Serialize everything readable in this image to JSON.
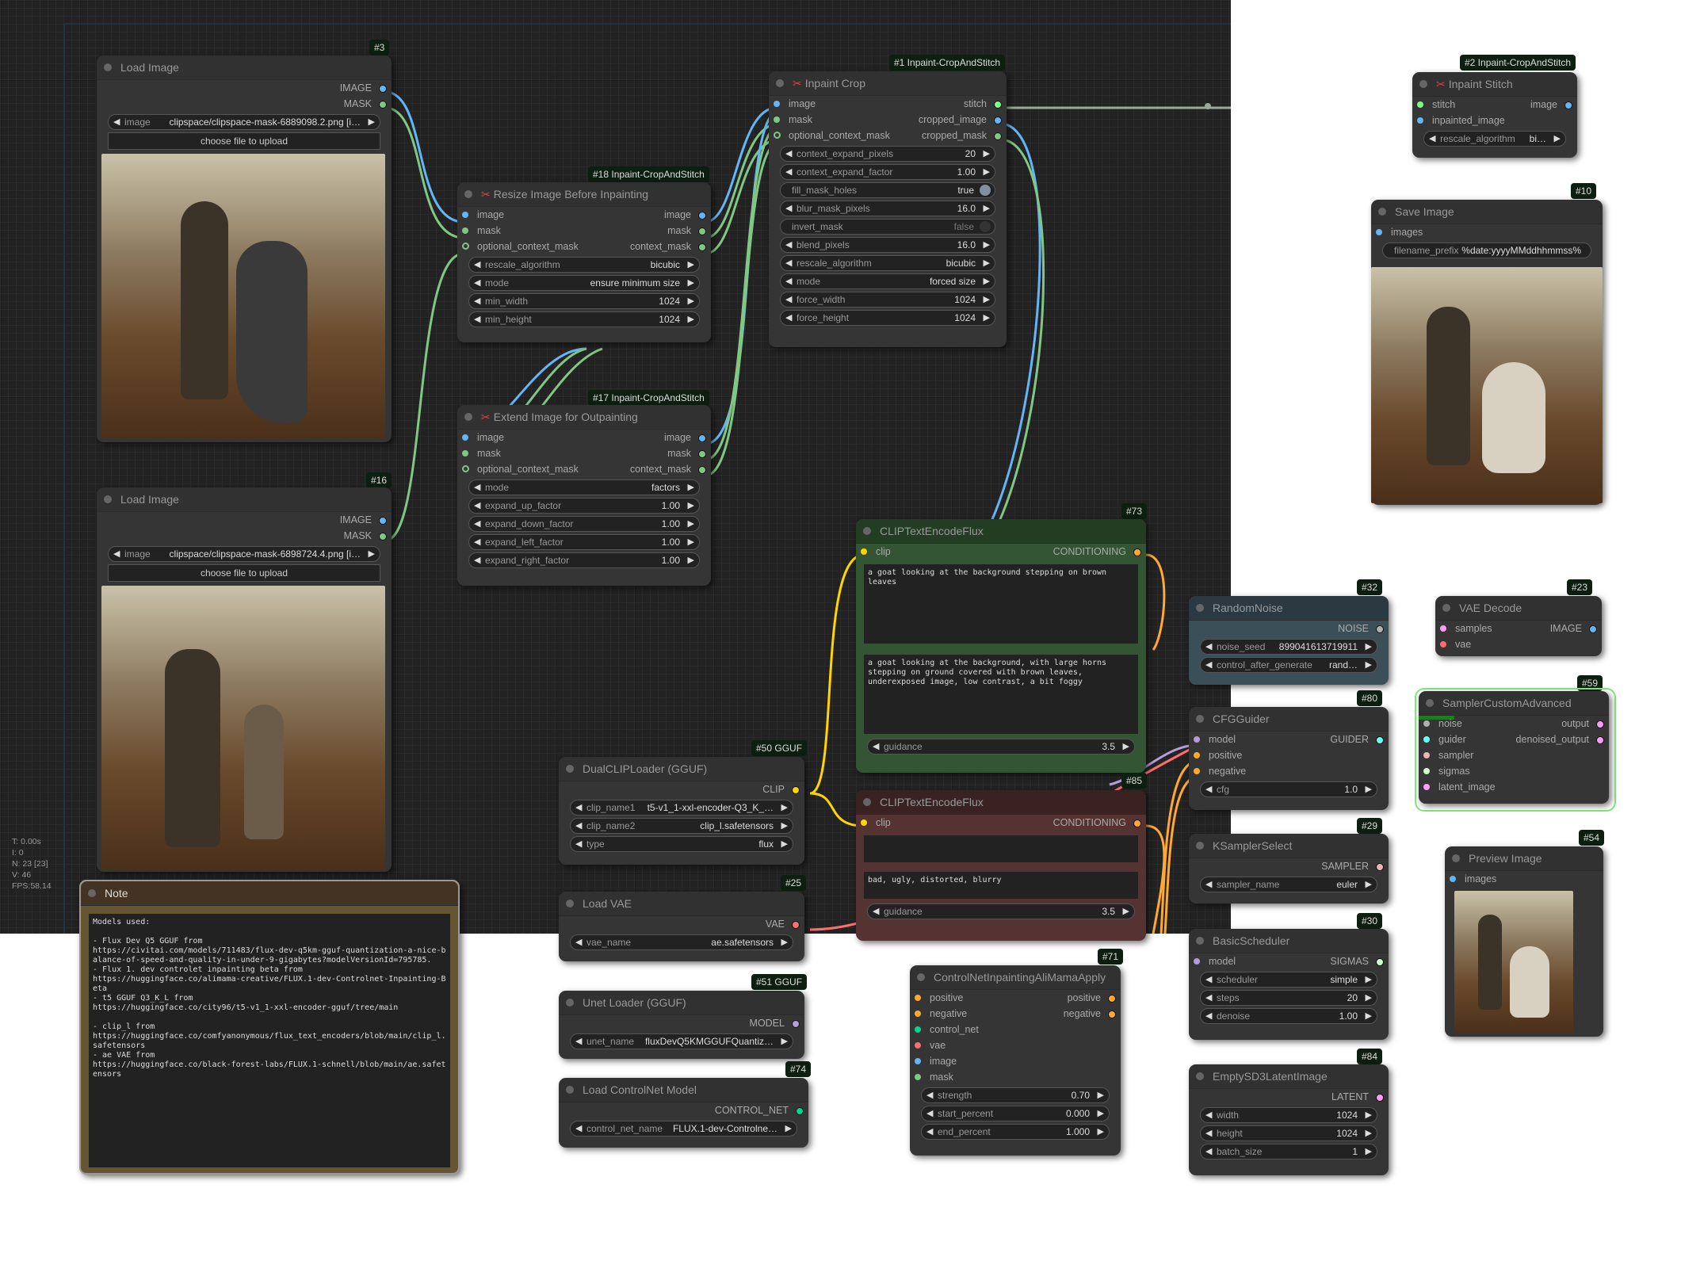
{
  "app": "ComfyUI",
  "stats": {
    "t": "T: 0.00s",
    "i": "I: 0",
    "n": "N: 23 [23]",
    "v": "V: 46",
    "fps": "FPS:58.14"
  },
  "colors": {
    "image": "#64b5f6",
    "mask": "#81c784",
    "clip": "#ffd500",
    "conditioning": "#ffa931",
    "vae": "#ff6e6e",
    "model": "#b39ddb",
    "latent": "#ff9cf9",
    "control_net": "#00d78d",
    "stitch": "#7fff7f",
    "guider": "#66ffff",
    "sampler": "#ecb4b4",
    "sigmas": "#cdffcd",
    "noise": "#b0b0b0"
  },
  "nodes": {
    "load_image_3": {
      "badge": "#3",
      "title": "Load Image",
      "outputs": [
        "IMAGE",
        "MASK"
      ],
      "image_label": "image",
      "image_value": "clipspace/clipspace-mask-6889098.2.png [i…",
      "upload": "choose file to upload"
    },
    "load_image_16": {
      "badge": "#16",
      "title": "Load Image",
      "outputs": [
        "IMAGE",
        "MASK"
      ],
      "image_label": "image",
      "image_value": "clipspace/clipspace-mask-6898724.4.png [i…",
      "upload": "choose file to upload"
    },
    "resize_18": {
      "badge": "#18 Inpaint-CropAndStitch",
      "title": "Resize Image Before Inpainting",
      "inputs": [
        "image",
        "mask",
        "optional_context_mask"
      ],
      "outputs": [
        "image",
        "mask",
        "context_mask"
      ],
      "widgets": [
        {
          "label": "rescale_algorithm",
          "value": "bicubic"
        },
        {
          "label": "mode",
          "value": "ensure minimum size"
        },
        {
          "label": "min_width",
          "value": "1024"
        },
        {
          "label": "min_height",
          "value": "1024"
        }
      ]
    },
    "extend_17": {
      "badge": "#17 Inpaint-CropAndStitch",
      "title": "Extend Image for Outpainting",
      "inputs": [
        "image",
        "mask",
        "optional_context_mask"
      ],
      "outputs": [
        "image",
        "mask",
        "context_mask"
      ],
      "widgets": [
        {
          "label": "mode",
          "value": "factors"
        },
        {
          "label": "expand_up_factor",
          "value": "1.00"
        },
        {
          "label": "expand_down_factor",
          "value": "1.00"
        },
        {
          "label": "expand_left_factor",
          "value": "1.00"
        },
        {
          "label": "expand_right_factor",
          "value": "1.00"
        }
      ]
    },
    "crop_1": {
      "badge": "#1 Inpaint-CropAndStitch",
      "title": "Inpaint Crop",
      "inputs": [
        "image",
        "mask",
        "optional_context_mask"
      ],
      "outputs": [
        "stitch",
        "cropped_image",
        "cropped_mask"
      ],
      "widgets": [
        {
          "label": "context_expand_pixels",
          "value": "20"
        },
        {
          "label": "context_expand_factor",
          "value": "1.00"
        },
        {
          "label": "fill_mask_holes",
          "value": "true",
          "toggle": true,
          "on": true
        },
        {
          "label": "blur_mask_pixels",
          "value": "16.0"
        },
        {
          "label": "invert_mask",
          "value": "false",
          "toggle": true,
          "on": false
        },
        {
          "label": "blend_pixels",
          "value": "16.0"
        },
        {
          "label": "rescale_algorithm",
          "value": "bicubic"
        },
        {
          "label": "mode",
          "value": "forced size"
        },
        {
          "label": "force_width",
          "value": "1024"
        },
        {
          "label": "force_height",
          "value": "1024"
        }
      ]
    },
    "stitch_2": {
      "badge": "#2 Inpaint-CropAndStitch",
      "title": "Inpaint Stitch",
      "inputs": [
        "stitch",
        "inpainted_image"
      ],
      "outputs": [
        "image"
      ],
      "widgets": [
        {
          "label": "rescale_algorithm",
          "value": "bi…"
        }
      ]
    },
    "save_10": {
      "badge": "#10",
      "title": "Save Image",
      "inputs": [
        "images"
      ],
      "widgets": [
        {
          "label": "filename_prefix",
          "value": "%date:yyyyMMddhhmmss%"
        }
      ]
    },
    "clip_pos_73": {
      "badge": "#73",
      "title": "CLIPTextEncodeFlux",
      "inputs": [
        "clip"
      ],
      "outputs": [
        "CONDITIONING"
      ],
      "clip_l": "a goat looking at the background stepping on brown leaves",
      "t5xxl": "a goat looking at the background, with large horns\nstepping on ground covered with brown leaves,\nunderexposed image, low contrast, a bit foggy",
      "widgets": [
        {
          "label": "guidance",
          "value": "3.5"
        }
      ]
    },
    "clip_neg_85": {
      "badge": "#85",
      "title": "CLIPTextEncodeFlux",
      "inputs": [
        "clip"
      ],
      "outputs": [
        "CONDITIONING"
      ],
      "clip_l": "",
      "t5xxl": "bad, ugly, distorted, blurry",
      "widgets": [
        {
          "label": "guidance",
          "value": "3.5"
        }
      ]
    },
    "dualclip_50": {
      "badge": "#50 GGUF",
      "title": "DualCLIPLoader (GGUF)",
      "outputs": [
        "CLIP"
      ],
      "widgets": [
        {
          "label": "clip_name1",
          "value": "t5-v1_1-xxl-encoder-Q3_K_…"
        },
        {
          "label": "clip_name2",
          "value": "clip_l.safetensors"
        },
        {
          "label": "type",
          "value": "flux"
        }
      ]
    },
    "vae_25": {
      "badge": "#25",
      "title": "Load VAE",
      "outputs": [
        "VAE"
      ],
      "widgets": [
        {
          "label": "vae_name",
          "value": "ae.safetensors"
        }
      ]
    },
    "unet_51": {
      "badge": "#51 GGUF",
      "title": "Unet Loader (GGUF)",
      "outputs": [
        "MODEL"
      ],
      "widgets": [
        {
          "label": "unet_name",
          "value": "fluxDevQ5KMGGUFQuantiz…"
        }
      ]
    },
    "controlnet_74": {
      "badge": "#74",
      "title": "Load ControlNet Model",
      "outputs": [
        "CONTROL_NET"
      ],
      "widgets": [
        {
          "label": "control_net_name",
          "value": "FLUX.1-dev-Controlne…"
        }
      ]
    },
    "cn_apply_71": {
      "badge": "#71",
      "title": "ControlNetInpaintingAliMamaApply",
      "inputs": [
        "positive",
        "negative",
        "control_net",
        "vae",
        "image",
        "mask"
      ],
      "outputs": [
        "positive",
        "negative"
      ],
      "widgets": [
        {
          "label": "strength",
          "value": "0.70"
        },
        {
          "label": "start_percent",
          "value": "0.000"
        },
        {
          "label": "end_percent",
          "value": "1.000"
        }
      ]
    },
    "noise_32": {
      "badge": "#32",
      "title": "RandomNoise",
      "outputs": [
        "NOISE"
      ],
      "widgets": [
        {
          "label": "noise_seed",
          "value": "899041613719911"
        },
        {
          "label": "control_after_generate",
          "value": "rand…"
        }
      ]
    },
    "cfg_80": {
      "badge": "#80",
      "title": "CFGGuider",
      "inputs": [
        "model",
        "positive",
        "negative"
      ],
      "outputs": [
        "GUIDER"
      ],
      "widgets": [
        {
          "label": "cfg",
          "value": "1.0"
        }
      ]
    },
    "ksampler_29": {
      "badge": "#29",
      "title": "KSamplerSelect",
      "outputs": [
        "SAMPLER"
      ],
      "widgets": [
        {
          "label": "sampler_name",
          "value": "euler"
        }
      ]
    },
    "scheduler_30": {
      "badge": "#30",
      "title": "BasicScheduler",
      "inputs": [
        "model"
      ],
      "outputs": [
        "SIGMAS"
      ],
      "widgets": [
        {
          "label": "scheduler",
          "value": "simple"
        },
        {
          "label": "steps",
          "value": "20"
        },
        {
          "label": "denoise",
          "value": "1.00"
        }
      ]
    },
    "latent_84": {
      "badge": "#84",
      "title": "EmptySD3LatentImage",
      "outputs": [
        "LATENT"
      ],
      "widgets": [
        {
          "label": "width",
          "value": "1024"
        },
        {
          "label": "height",
          "value": "1024"
        },
        {
          "label": "batch_size",
          "value": "1"
        }
      ]
    },
    "vaedecode_23": {
      "badge": "#23",
      "title": "VAE Decode",
      "inputs": [
        "samples",
        "vae"
      ],
      "outputs": [
        "IMAGE"
      ]
    },
    "sampler_59": {
      "badge": "#59",
      "title": "SamplerCustomAdvanced",
      "inputs": [
        "noise",
        "guider",
        "sampler",
        "sigmas",
        "latent_image"
      ],
      "outputs": [
        "output",
        "denoised_output"
      ]
    },
    "preview_54": {
      "badge": "#54",
      "title": "Preview Image",
      "inputs": [
        "images"
      ]
    },
    "note": {
      "title": "Note",
      "text": "Models used:\n\n- Flux Dev Q5 GGUF from\nhttps://civitai.com/models/711483/flux-dev-q5km-gguf-quantization-a-nice-balance-of-speed-and-quality-in-under-9-gigabytes?modelVersionId=795785.\n- Flux 1. dev controlet inpainting beta from\nhttps://huggingface.co/alimama-creative/FLUX.1-dev-Controlnet-Inpainting-Beta\n- t5 GGUF Q3_K_L from\nhttps://huggingface.co/city96/t5-v1_1-xxl-encoder-gguf/tree/main\n\n- clip_l from\nhttps://huggingface.co/comfyanonymous/flux_text_encoders/blob/main/clip_l.safetensors\n- ae VAE from\nhttps://huggingface.co/black-forest-labs/FLUX.1-schnell/blob/main/ae.safetensors"
    }
  }
}
